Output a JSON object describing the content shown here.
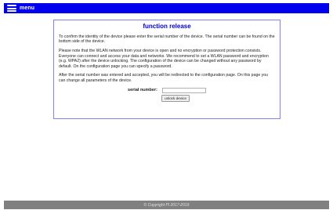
{
  "header": {
    "menu_icon": "hamburger-menu-icon",
    "menu_label": "menu",
    "bar_color": "#0000ee"
  },
  "main": {
    "title": "function release",
    "paragraph_1": "To confirm the identity of the device please enter the serial number of the device. The serial number can be found on the bottom side of the device.",
    "paragraph_2": "Please note that the WLAN network from your device is open and no encryption or password protection consists. Everyone can connect and access your data and networks. We recommend to set a WLAN password and encryption (e.g. WPA2) after the device unlocking. The configuration of the device can be changed without any password by default. On the configuration page you can specify a password.",
    "paragraph_3": "After the serial number was entered and accepted, you will be redirected to the configuration page. On this page you can change all parameters of the device.",
    "serial_label": "serial number:",
    "serial_value": "",
    "unlock_button": "unlock device",
    "title_color": "#0000cc",
    "border_color": "#8080ff"
  },
  "footer": {
    "copyright": "© Copyright PI 2017-2019",
    "bar_color": "#808080"
  }
}
